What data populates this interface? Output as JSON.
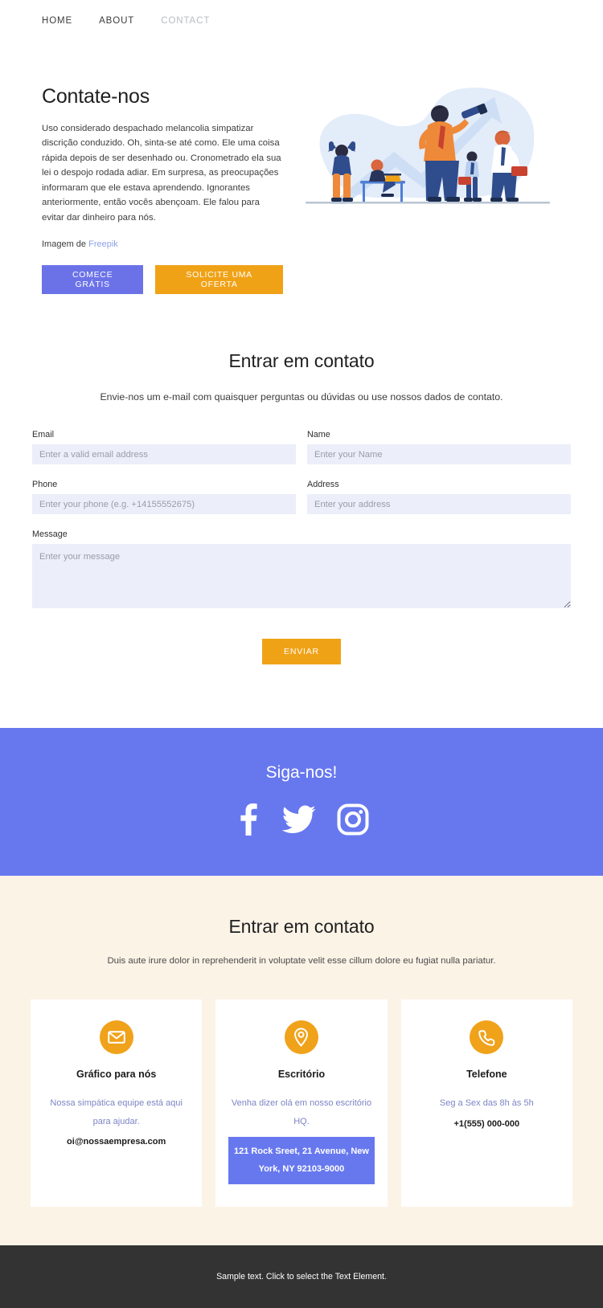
{
  "nav": {
    "items": [
      {
        "label": "HOME",
        "active": true
      },
      {
        "label": "ABOUT",
        "active": true
      },
      {
        "label": "CONTACT",
        "active": false
      }
    ]
  },
  "hero": {
    "title": "Contate-nos",
    "body": "Uso considerado despachado melancolia simpatizar discrição conduzido. Oh, sinta-se até como. Ele uma coisa rápida depois de ser desenhado ou. Cronometrado ela sua lei o despojo rodada adiar. Em surpresa, as preocupações informaram que ele estava aprendendo. Ignorantes anteriormente, então vocês abençoam. Ele falou para evitar dar dinheiro para nós.",
    "credit_prefix": "Imagem de ",
    "credit_link": "Freepik",
    "btn_primary": "COMECE GRÁTIS",
    "btn_secondary": "SOLICITE UMA OFERTA",
    "illustration": "business-growth-illustration"
  },
  "form": {
    "title": "Entrar em contato",
    "subtitle": "Envie-nos um e-mail com quaisquer perguntas ou dúvidas ou use nossos dados de contato.",
    "fields": [
      {
        "label": "Email",
        "placeholder": "Enter a valid email address",
        "value": ""
      },
      {
        "label": "Name",
        "placeholder": "Enter your Name",
        "value": ""
      },
      {
        "label": "Phone",
        "placeholder": "Enter your phone (e.g. +14155552675)",
        "value": ""
      },
      {
        "label": "Address",
        "placeholder": "Enter your address",
        "value": ""
      },
      {
        "label": "Message",
        "placeholder": "Enter your message",
        "value": ""
      }
    ],
    "submit_label": "ENVIAR"
  },
  "social": {
    "title": "Siga-nos!",
    "icons": [
      {
        "name": "facebook-icon"
      },
      {
        "name": "twitter-icon"
      },
      {
        "name": "instagram-icon"
      }
    ]
  },
  "contact": {
    "title": "Entrar em contato",
    "subtitle": "Duis aute irure dolor in reprehenderit in voluptate velit esse cillum dolore eu fugiat nulla pariatur.",
    "cards": [
      {
        "icon": "envelope-icon",
        "title": "Gráfico para nós",
        "description": "Nossa simpática equipe está aqui para ajudar.",
        "value": "oi@nossaempresa.com",
        "boxed": false
      },
      {
        "icon": "map-pin-icon",
        "title": "Escritório",
        "description": "Venha dizer olá em nosso escritório HQ.",
        "value": "121 Rock Sreet, 21 Avenue, New York, NY 92103-9000",
        "boxed": true
      },
      {
        "icon": "phone-icon",
        "title": "Telefone",
        "description": "Seg a Sex das 8h às 5h",
        "value": "+1(555) 000-000",
        "boxed": false
      }
    ]
  },
  "footer": {
    "text": "Sample text. Click to select the Text Element."
  },
  "colors": {
    "purple": "#6778ef",
    "button_purple": "#6b72e8",
    "orange": "#f0a217",
    "cream": "#fcf3e7",
    "field_bg": "#eceef9",
    "footer_bg": "#333333",
    "link_blue": "#8da2e8",
    "card_desc": "#7d85c4"
  }
}
